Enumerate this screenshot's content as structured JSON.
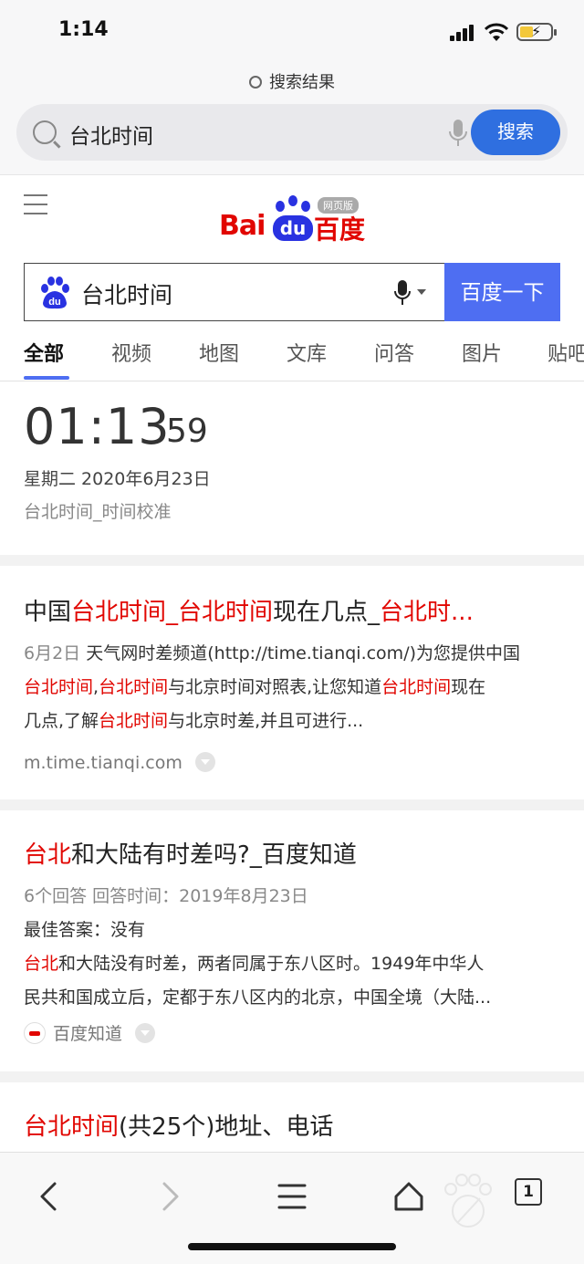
{
  "status_bar": {
    "time": "1:14"
  },
  "header": {
    "title": "搜索结果",
    "search_query": "台北时间",
    "search_button": "搜索"
  },
  "baidu": {
    "logo_bai": "Bai",
    "logo_du": "du",
    "logo_cn": "百度",
    "logo_badge": "网页版",
    "search_query": "台北时间",
    "search_button": "百度一下",
    "brand_colors": {
      "red": "#e10601",
      "blue": "#2932e1",
      "button": "#4e6ef2"
    }
  },
  "tabs": [
    "全部",
    "视频",
    "地图",
    "文库",
    "问答",
    "图片",
    "贴吧"
  ],
  "time_card": {
    "clock": "01:13",
    "seconds": "59",
    "date": "星期二 2020年6月23日",
    "source": "台北时间_时间校准"
  },
  "results": [
    {
      "title_parts": [
        "中国",
        "台北时间_台北时间",
        "现在几点_",
        "台北时..."
      ],
      "snippet_date": "6月2日",
      "snippet_line1": "天气网时差频道(http://time.tianqi.com/)为您提供中国",
      "snippet_line2_a": "台北时间",
      "snippet_line2_b": ",",
      "snippet_line2_c": "台北时间",
      "snippet_line2_d": "与北京时间对照表,让您知道",
      "snippet_line2_e": "台北时间",
      "snippet_line2_f": "现在",
      "snippet_line3_a": "几点,了解",
      "snippet_line3_b": "台北时间",
      "snippet_line3_c": "与北京时差,并且可进行...",
      "url": "m.time.tianqi.com"
    },
    {
      "title_red": "台北",
      "title_rest": "和大陆有时差吗?_百度知道",
      "meta": "6个回答   回答时间：2019年8月23日",
      "best_answer": "最佳答案：没有",
      "answer_red": "台北",
      "answer_line1": "和大陆没有时差，两者同属于东八区时。1949年中华人",
      "answer_line2": "民共和国成立后，定都于东八区内的北京，中国全境（大陆...",
      "source": "百度知道"
    },
    {
      "title_red": "台北时间",
      "title_rest": "(共25个)地址、电话"
    }
  ],
  "bottom_bar": {
    "tab_count": "1"
  }
}
